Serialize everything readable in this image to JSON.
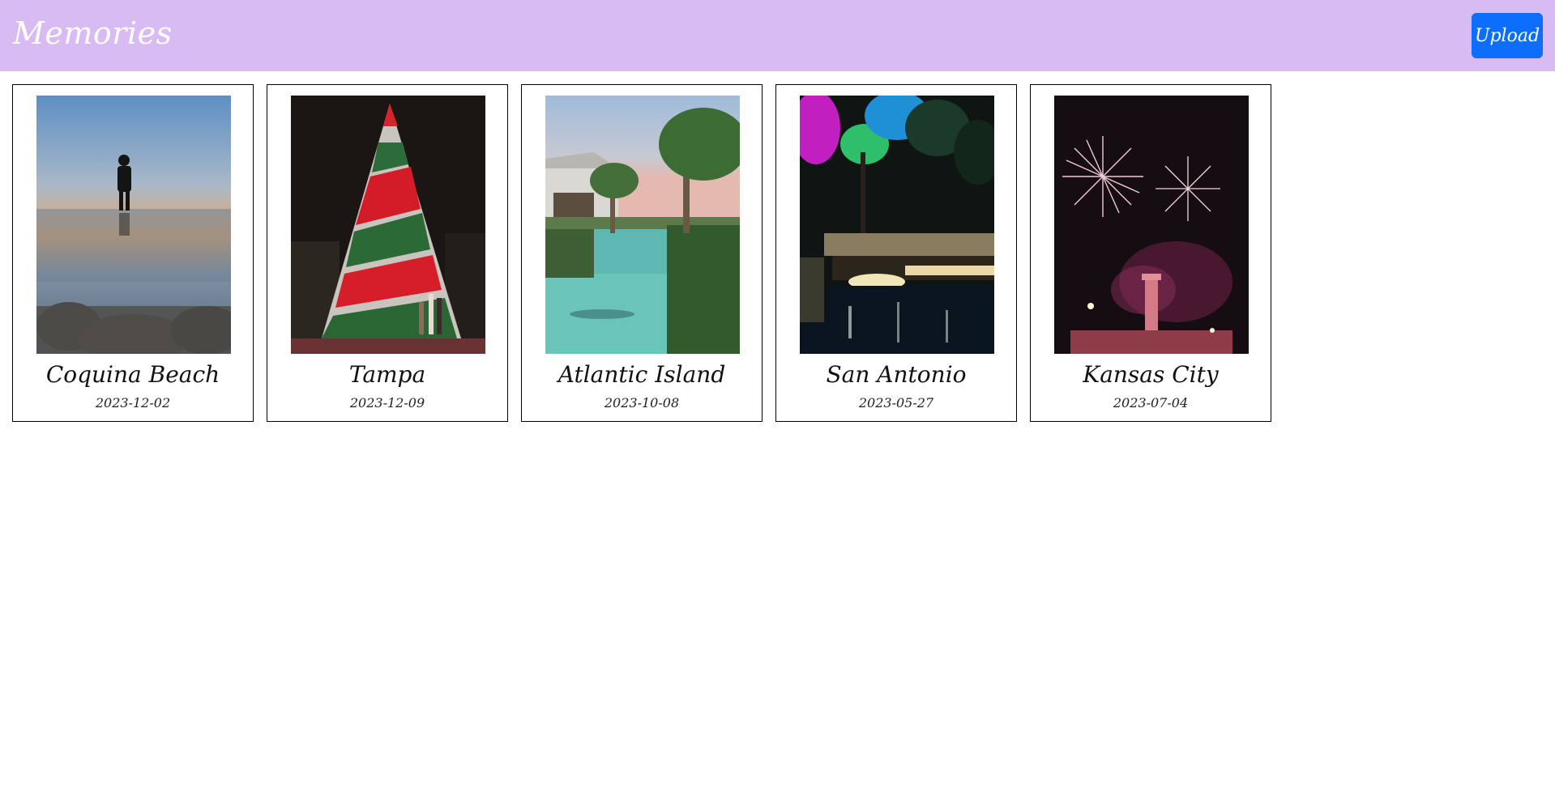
{
  "header": {
    "title": "Memories",
    "upload_label": "Upload",
    "background_color": "#d8bbf2",
    "button_color": "#0d6efd"
  },
  "memories": [
    {
      "place": "Coquina Beach",
      "date": "2023-12-02",
      "photo": "sunset-beach-silhouette"
    },
    {
      "place": "Tampa",
      "date": "2023-12-09",
      "photo": "striped-christmas-tree"
    },
    {
      "place": "Atlantic Island",
      "date": "2023-10-08",
      "photo": "resort-lagoon-palms"
    },
    {
      "place": "San Antonio",
      "date": "2023-05-27",
      "photo": "riverwalk-night-lights"
    },
    {
      "place": "Kansas City",
      "date": "2023-07-04",
      "photo": "fireworks-over-memorial"
    }
  ]
}
